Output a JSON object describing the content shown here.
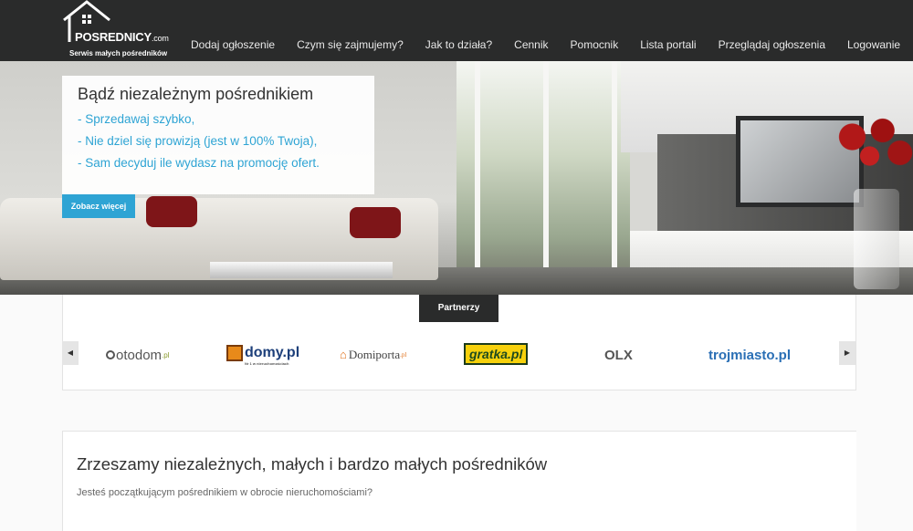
{
  "logo": {
    "name": "POSREDNICY",
    "domain": ".com",
    "tagline": "Serwis małych pośredników"
  },
  "nav": [
    "Dodaj ogłoszenie",
    "Czym się zajmujemy?",
    "Jak to działa?",
    "Cennik",
    "Pomocnik",
    "Lista portali",
    "Przeglądaj ogłoszenia",
    "Logowanie"
  ],
  "hero": {
    "title": "Bądź niezależnym pośrednikiem",
    "lines": [
      "- Sprzedawaj szybko,",
      "- Nie dziel się prowizją (jest w 100% Twoja),",
      "- Sam decyduj ile wydasz na promocję ofert."
    ],
    "button": "Zobacz więcej"
  },
  "partners": {
    "tab": "Partnerzy",
    "prev": "◀",
    "next": "▶",
    "logos": [
      "otodom",
      "domy.pl",
      "Domiporta",
      "gratka.pl",
      "OLX",
      "trojmiasto.pl"
    ],
    "domy_tagline": "Nr 1 w nieruchomościach",
    "suffix_pl": ".pl"
  },
  "content": {
    "title": "Zrzeszamy niezależnych, małych i bardzo małych pośredników",
    "text": "Jesteś początkującym pośrednikiem w obrocie nieruchomościami?"
  },
  "colors": {
    "accent": "#2ea4d4",
    "topbar": "#2a2b2b"
  }
}
